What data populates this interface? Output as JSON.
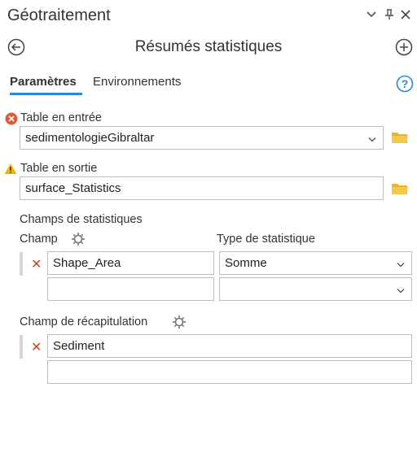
{
  "pane": {
    "title": "Géotraitement"
  },
  "tool": {
    "title": "Résumés statistiques"
  },
  "tabs": [
    {
      "label": "Paramètres",
      "active": true
    },
    {
      "label": "Environnements",
      "active": false
    }
  ],
  "params": {
    "input_table": {
      "label": "Table en entrée",
      "value": "sedimentologieGibraltar",
      "status": "error"
    },
    "output_table": {
      "label": "Table en sortie",
      "value": "surface_Statistics",
      "status": "warning"
    },
    "stat_fields": {
      "section_label": "Champs de statistiques",
      "col_field": "Champ",
      "col_type": "Type de statistique",
      "rows": [
        {
          "field": "Shape_Area",
          "type": "Somme"
        },
        {
          "field": "",
          "type": ""
        }
      ]
    },
    "case_field": {
      "label": "Champ de récapitulation",
      "rows": [
        {
          "field": "Sediment"
        },
        {
          "field": ""
        }
      ]
    }
  },
  "colors": {
    "accent": "#2b88d8",
    "error": "#e05a3a",
    "warning": "#f0b400",
    "folder": "#e8b429",
    "remove": "#d23c1f"
  },
  "icons": [
    "chevron-down-icon",
    "pin-icon",
    "close-icon",
    "back-icon",
    "add-icon",
    "help-icon",
    "error-icon",
    "warning-icon",
    "folder-icon",
    "gear-icon",
    "remove-icon"
  ]
}
